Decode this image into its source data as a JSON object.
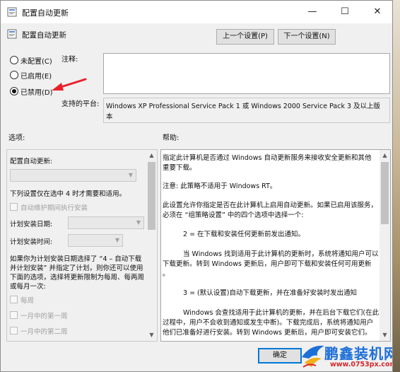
{
  "window": {
    "title": "配置自动更新",
    "minimize_icon": "—",
    "maximize_icon": "☐",
    "close_icon": "✕"
  },
  "header": {
    "policy_title": "配置自动更新",
    "prev_button": "上一个设置(P)",
    "next_button": "下一个设置(N)"
  },
  "state": {
    "options": [
      {
        "label": "未配置(C)",
        "checked": false
      },
      {
        "label": "已启用(E)",
        "checked": false
      },
      {
        "label": "已禁用(D)",
        "checked": true
      }
    ]
  },
  "comment": {
    "label": "注释:",
    "value": ""
  },
  "platform": {
    "label": "支持的平台:",
    "lines": [
      "Windows XP Professional Service Pack 1 或 Windows 2000 Service Pack 3 及以上版",
      "本"
    ]
  },
  "sections": {
    "options_label": "选项:",
    "help_label": "帮助:"
  },
  "options_panel": {
    "heading": "配置自动更新:",
    "note": "下列设置仅在选中 4 时才需要和适用。",
    "maintenance_checkbox": "自动维护期间执行安装",
    "install_day_label": "计划安装日期:",
    "install_time_label": "计划安装时间:",
    "paragraph": [
      "如果你为计划安装日期选择了 “4 – 自动下载",
      "并计划安装” 并指定了计划，则你还可以使用",
      "下面的选项，选择将更新限制为每周、每两周",
      "或每月一次:"
    ],
    "week_options": [
      "每周",
      "一月中的第一周",
      "一月中的第二周"
    ]
  },
  "help_panel": {
    "lines": [
      "指定此计算机是否通过 Windows 自动更新服务来接收安全更新和其他",
      "重要下载。",
      "注意: 此策略不适用于 Windows RT。",
      "此设置允许你指定是否在此计算机上启用自动更新。如果已启用该服务，",
      "必须在 “组策略设置” 中的四个选项中选择一个:",
      "2 = 在下载和安装任何更新前发出通知。",
      "当 Windows 找到适用于此计算机的更新时，系统将通知用户可以",
      "下载更新。转到 Windows 更新后，用户即可下载和安装任何可用更新",
      "。",
      "3 = (默认设置)自动下载更新，并在准备好安装时发出通知",
      "Windows 会查找适用于此计算机的更新，并在后台下载它们(在此",
      "过程中，用户不会收到通知或发生中断)。下载完成后，系统将通知用户",
      "他们已准备好进行安装。转到 Windows 更新后，用户即可安装它们。"
    ]
  },
  "footer": {
    "ok_button": "确定"
  },
  "watermark": {
    "brand": "鹏鑫装机网",
    "url": "www.0753px.com"
  },
  "colors": {
    "annotation_arrow": "#e8202a",
    "focus_border": "#0078d7",
    "brand_blue": "#1d6fd8"
  }
}
